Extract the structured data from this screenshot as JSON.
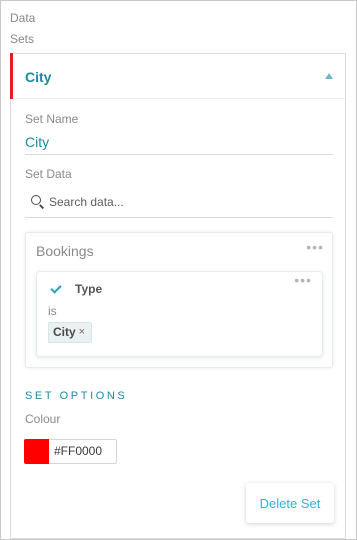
{
  "breadcrumb": {
    "line1": "Data",
    "line2": "Sets"
  },
  "panel": {
    "title": "City",
    "accent_color": "#E11D1D"
  },
  "set_name": {
    "label": "Set Name",
    "value": "City"
  },
  "set_data": {
    "label": "Set Data",
    "search_placeholder": "Search data..."
  },
  "bookings": {
    "title": "Bookings",
    "menu_glyph": "•••",
    "filter": {
      "field": "Type",
      "operator": "is",
      "chips": [
        {
          "label": "City",
          "remove": "×"
        }
      ],
      "menu_glyph": "•••"
    }
  },
  "set_options": {
    "heading": "SET OPTIONS",
    "colour_label": "Colour",
    "colour_hex": "#FF0000"
  },
  "actions": {
    "delete_label": "Delete Set"
  },
  "colors": {
    "accent": "#1C8AA5",
    "link": "#26B6E0",
    "swatch": "#FF0000"
  }
}
